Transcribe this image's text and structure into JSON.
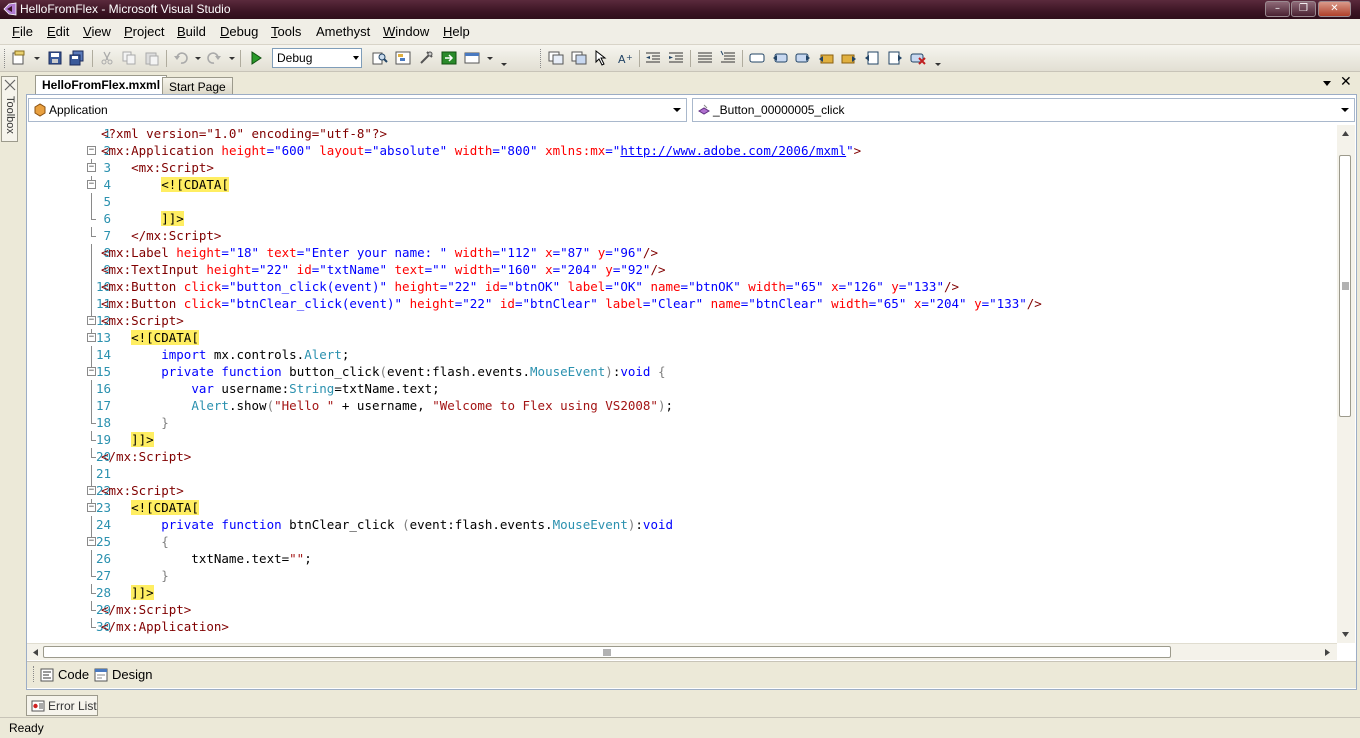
{
  "window": {
    "title": "HelloFromFlex - Microsoft Visual Studio",
    "accent": "#3c1424"
  },
  "menu": {
    "items": [
      {
        "key": "F",
        "rest": "ile"
      },
      {
        "key": "E",
        "rest": "dit"
      },
      {
        "key": "V",
        "rest": "iew"
      },
      {
        "key": "P",
        "rest": "roject"
      },
      {
        "key": "B",
        "rest": "uild"
      },
      {
        "key": "D",
        "rest": "ebug"
      },
      {
        "key": "T",
        "rest": "ools"
      },
      {
        "key": "",
        "rest": "Amethyst"
      },
      {
        "key": "W",
        "rest": "indow"
      },
      {
        "key": "H",
        "rest": "elp"
      }
    ]
  },
  "toolbar": {
    "configuration": "Debug"
  },
  "toolbox": {
    "label": "Toolbox"
  },
  "tabs": {
    "active": "HelloFromFlex.mxml",
    "inactive": "Start Page"
  },
  "nav": {
    "left": "Application",
    "right": "_Button_00000005_click"
  },
  "code": {
    "lines": [
      {
        "n": "1",
        "tokens": [
          [
            "pi",
            "<?xml version=\"1.0\" encoding=\"utf-8\"?>"
          ]
        ]
      },
      {
        "n": "2",
        "tokens": [
          [
            "tag",
            "<mx:Application "
          ],
          [
            "attr",
            "height"
          ],
          [
            "val",
            "=\"600\" "
          ],
          [
            "attr",
            "layout"
          ],
          [
            "val",
            "=\"absolute\" "
          ],
          [
            "attr",
            "width"
          ],
          [
            "val",
            "=\"800\" "
          ],
          [
            "attr",
            "xmlns:mx"
          ],
          [
            "val",
            "=\""
          ],
          [
            "link",
            "http://www.adobe.com/2006/mxml"
          ],
          [
            "val",
            "\""
          ],
          [
            "tag",
            ">"
          ]
        ]
      },
      {
        "n": "3",
        "tokens": [
          [
            "plain",
            "    "
          ],
          [
            "tag",
            "<mx:Script>"
          ]
        ]
      },
      {
        "n": "4",
        "tokens": [
          [
            "plain",
            "        "
          ],
          [
            "cdata",
            "<![CDATA["
          ]
        ]
      },
      {
        "n": "5",
        "tokens": []
      },
      {
        "n": "6",
        "tokens": [
          [
            "plain",
            "        "
          ],
          [
            "cdata",
            "]]>"
          ]
        ]
      },
      {
        "n": "7",
        "tokens": [
          [
            "plain",
            "    "
          ],
          [
            "tag",
            "</mx:Script>"
          ]
        ]
      },
      {
        "n": "8",
        "tokens": [
          [
            "tag",
            "<mx:Label "
          ],
          [
            "attr",
            "height"
          ],
          [
            "val",
            "=\"18\" "
          ],
          [
            "attr",
            "text"
          ],
          [
            "val",
            "=\"Enter your name: \" "
          ],
          [
            "attr",
            "width"
          ],
          [
            "val",
            "=\"112\" "
          ],
          [
            "attr",
            "x"
          ],
          [
            "val",
            "=\"87\" "
          ],
          [
            "attr",
            "y"
          ],
          [
            "val",
            "=\"96\""
          ],
          [
            "tag",
            "/>"
          ]
        ]
      },
      {
        "n": "9",
        "tokens": [
          [
            "tag",
            "<mx:TextInput "
          ],
          [
            "attr",
            "height"
          ],
          [
            "val",
            "=\"22\" "
          ],
          [
            "attr",
            "id"
          ],
          [
            "val",
            "=\"txtName\" "
          ],
          [
            "attr",
            "text"
          ],
          [
            "val",
            "=\"\" "
          ],
          [
            "attr",
            "width"
          ],
          [
            "val",
            "=\"160\" "
          ],
          [
            "attr",
            "x"
          ],
          [
            "val",
            "=\"204\" "
          ],
          [
            "attr",
            "y"
          ],
          [
            "val",
            "=\"92\""
          ],
          [
            "tag",
            "/>"
          ]
        ]
      },
      {
        "n": "10",
        "tokens": [
          [
            "tag",
            "<mx:Button "
          ],
          [
            "attr",
            "click"
          ],
          [
            "val",
            "=\"button_click(event)\" "
          ],
          [
            "attr",
            "height"
          ],
          [
            "val",
            "=\"22\" "
          ],
          [
            "attr",
            "id"
          ],
          [
            "val",
            "=\"btnOK\" "
          ],
          [
            "attr",
            "label"
          ],
          [
            "val",
            "=\"OK\" "
          ],
          [
            "attr",
            "name"
          ],
          [
            "val",
            "=\"btnOK\" "
          ],
          [
            "attr",
            "width"
          ],
          [
            "val",
            "=\"65\" "
          ],
          [
            "attr",
            "x"
          ],
          [
            "val",
            "=\"126\" "
          ],
          [
            "attr",
            "y"
          ],
          [
            "val",
            "=\"133\""
          ],
          [
            "tag",
            "/>"
          ]
        ]
      },
      {
        "n": "11",
        "tokens": [
          [
            "tag",
            "<mx:Button "
          ],
          [
            "attr",
            "click"
          ],
          [
            "val",
            "=\"btnClear_click(event)\" "
          ],
          [
            "attr",
            "height"
          ],
          [
            "val",
            "=\"22\" "
          ],
          [
            "attr",
            "id"
          ],
          [
            "val",
            "=\"btnClear\" "
          ],
          [
            "attr",
            "label"
          ],
          [
            "val",
            "=\"Clear\" "
          ],
          [
            "attr",
            "name"
          ],
          [
            "val",
            "=\"btnClear\" "
          ],
          [
            "attr",
            "width"
          ],
          [
            "val",
            "=\"65\" "
          ],
          [
            "attr",
            "x"
          ],
          [
            "val",
            "=\"204\" "
          ],
          [
            "attr",
            "y"
          ],
          [
            "val",
            "=\"133\""
          ],
          [
            "tag",
            "/>"
          ]
        ]
      },
      {
        "n": "12",
        "tokens": [
          [
            "tag",
            "<mx:Script>"
          ]
        ]
      },
      {
        "n": "13",
        "tokens": [
          [
            "plain",
            "    "
          ],
          [
            "cdata",
            "<![CDATA["
          ]
        ]
      },
      {
        "n": "14",
        "tokens": [
          [
            "plain",
            "        "
          ],
          [
            "kw",
            "import"
          ],
          [
            "plain",
            " mx.controls."
          ],
          [
            "type",
            "Alert"
          ],
          [
            "plain",
            ";"
          ]
        ]
      },
      {
        "n": "15",
        "tokens": [
          [
            "plain",
            "        "
          ],
          [
            "kw",
            "private function"
          ],
          [
            "plain",
            " button_click"
          ],
          [
            "brace",
            "("
          ],
          [
            "plain",
            "event:flash.events."
          ],
          [
            "type",
            "MouseEvent"
          ],
          [
            "brace",
            ")"
          ],
          [
            "plain",
            ":"
          ],
          [
            "kw",
            "void"
          ],
          [
            "brace",
            " {"
          ]
        ]
      },
      {
        "n": "16",
        "tokens": [
          [
            "plain",
            "            "
          ],
          [
            "kw",
            "var"
          ],
          [
            "plain",
            " username:"
          ],
          [
            "type",
            "String"
          ],
          [
            "plain",
            "=txtName.text;"
          ]
        ]
      },
      {
        "n": "17",
        "tokens": [
          [
            "plain",
            "            "
          ],
          [
            "type",
            "Alert"
          ],
          [
            "plain",
            ".show"
          ],
          [
            "brace",
            "("
          ],
          [
            "str",
            "\"Hello \""
          ],
          [
            "plain",
            " + username, "
          ],
          [
            "str",
            "\"Welcome to Flex using VS2008\""
          ],
          [
            "brace",
            ")"
          ],
          [
            "plain",
            ";"
          ]
        ]
      },
      {
        "n": "18",
        "tokens": [
          [
            "plain",
            "        "
          ],
          [
            "brace",
            "}"
          ]
        ]
      },
      {
        "n": "19",
        "tokens": [
          [
            "plain",
            "    "
          ],
          [
            "cdata",
            "]]>"
          ]
        ]
      },
      {
        "n": "20",
        "tokens": [
          [
            "tag",
            "</mx:Script>"
          ]
        ]
      },
      {
        "n": "21",
        "tokens": []
      },
      {
        "n": "22",
        "tokens": [
          [
            "tag",
            "<mx:Script>"
          ]
        ]
      },
      {
        "n": "23",
        "tokens": [
          [
            "plain",
            "    "
          ],
          [
            "cdata",
            "<![CDATA["
          ]
        ]
      },
      {
        "n": "24",
        "tokens": [
          [
            "plain",
            "        "
          ],
          [
            "kw",
            "private function"
          ],
          [
            "plain",
            " btnClear_click "
          ],
          [
            "brace",
            "("
          ],
          [
            "plain",
            "event:flash.events."
          ],
          [
            "type",
            "MouseEvent"
          ],
          [
            "brace",
            ")"
          ],
          [
            "plain",
            ":"
          ],
          [
            "kw",
            "void"
          ]
        ]
      },
      {
        "n": "25",
        "tokens": [
          [
            "plain",
            "        "
          ],
          [
            "brace",
            "{"
          ]
        ]
      },
      {
        "n": "26",
        "tokens": [
          [
            "plain",
            "            txtName.text="
          ],
          [
            "str",
            "\"\""
          ],
          [
            "plain",
            ";"
          ]
        ]
      },
      {
        "n": "27",
        "tokens": [
          [
            "plain",
            "        "
          ],
          [
            "brace",
            "}"
          ]
        ]
      },
      {
        "n": "28",
        "tokens": [
          [
            "plain",
            "    "
          ],
          [
            "cdata",
            "]]>"
          ]
        ]
      },
      {
        "n": "29",
        "tokens": [
          [
            "tag",
            "</mx:Script>"
          ]
        ]
      },
      {
        "n": "30",
        "tokens": [
          [
            "tag",
            "</mx:Application>"
          ]
        ]
      }
    ]
  },
  "views": {
    "code": "Code",
    "design": "Design"
  },
  "errorlist": {
    "label": "Error List"
  },
  "status": {
    "text": "Ready"
  }
}
